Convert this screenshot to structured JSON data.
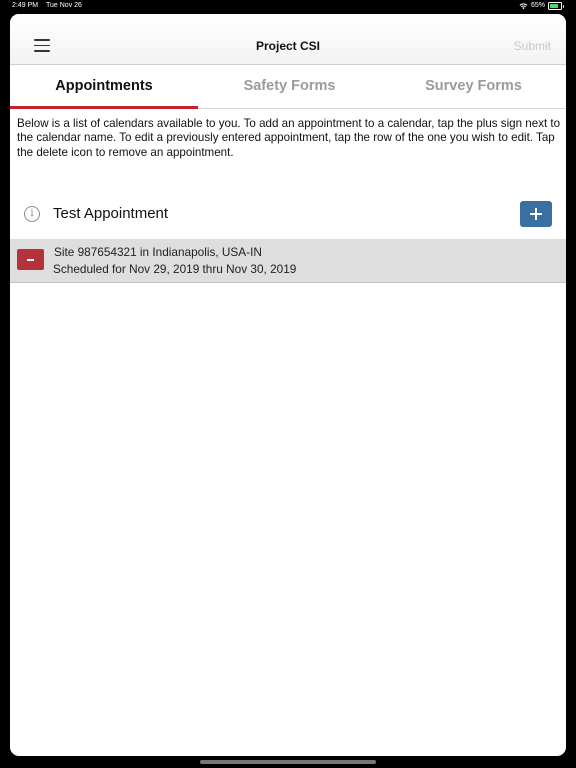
{
  "status_bar": {
    "time": "2:49 PM",
    "date": "Tue Nov 26",
    "battery": "65%",
    "battery_level": 0.65
  },
  "nav": {
    "title": "Project CSI",
    "submit_label": "Submit",
    "menu_icon": "hamburger-icon"
  },
  "tabs": [
    {
      "label": "Appointments",
      "active": true
    },
    {
      "label": "Safety Forms",
      "active": false
    },
    {
      "label": "Survey Forms",
      "active": false
    }
  ],
  "description": "Below is a list of calendars available to you. To add an appointment to a calendar, tap the plus sign next to the calendar name. To edit a previously entered appointment, tap the row of the one you wish to edit. Tap the delete icon to remove an appointment.",
  "calendar": {
    "name": "Test Appointment",
    "info_icon": "info-icon",
    "add_icon": "plus-icon",
    "appointments": [
      {
        "site": "Site 987654321 in Indianapolis, USA-IN",
        "schedule": "Scheduled for Nov 29, 2019 thru Nov 30, 2019",
        "delete_icon": "minus-icon"
      }
    ]
  },
  "colors": {
    "accent_red": "#c52228",
    "add_button_blue": "#3a6fa1",
    "delete_button_red": "#b4333a",
    "row_background": "#dedede"
  }
}
